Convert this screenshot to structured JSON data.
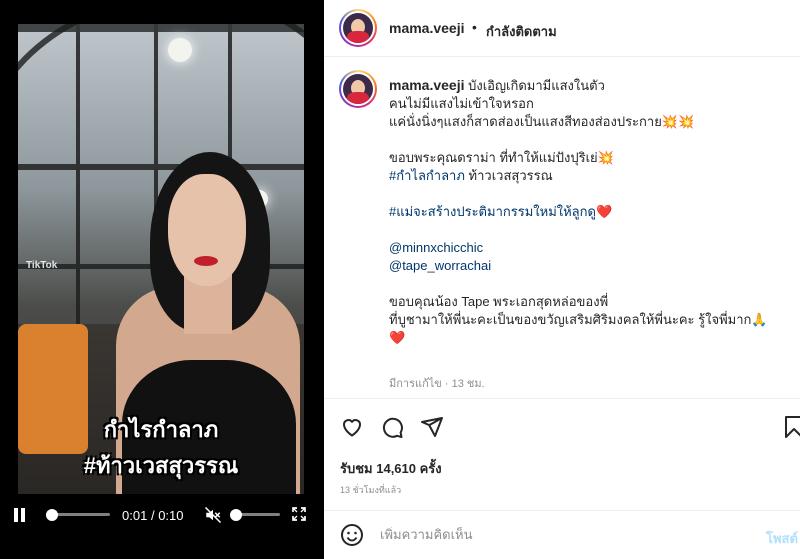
{
  "video": {
    "overlay_line1": "กำไรกำลาภ",
    "overlay_line2": "#ท้าวเวสสุวรรณ",
    "watermark": "TikTok",
    "time_current": "0:01",
    "time_separator": "/",
    "time_total": "0:10",
    "progress_fraction": 0.1,
    "volume_fraction": 0.0
  },
  "header": {
    "username": "mama.veeji",
    "separator": "•",
    "follow_status": "กำลังติดตาม"
  },
  "caption": {
    "username": "mama.veeji",
    "lines": [
      "บังเอิญเกิดมามีแสงในตัว",
      "คนไม่มีแสงไม่เข้าใจหรอก",
      "แค่นั่งนิ่งๆแสงก็สาดส่องเป็นแสงสีทองส่องประกาย💥💥",
      "",
      "ขอบพระคุณดราม่า ที่ทำให้แม่ปังปุริเย่💥",
      "ท้าวเวสสุวรรณ",
      "",
      "❤️",
      "",
      "",
      "",
      "ขอบคุณน้อง Tape พระเอกสุดหล่อของพี่",
      "ที่บูชามาให้พี่นะคะเป็นของขวัญเสริมศิริมงคลให้พี่นะคะ รู้ใจพี่มาก🙏",
      "❤️"
    ],
    "hashtag1": "#กำไลกำลาภ",
    "hashtag2": "#แม่จะสร้างประติมากรรมใหม่ให้ลูกดู",
    "mention1": "@minnxchicchic",
    "mention2": "@tape_worrachai",
    "edited_meta": "มีการแก้ไข · 13 ชม."
  },
  "actions": {
    "like_icon": "heart-icon",
    "comment_icon": "comment-icon",
    "share_icon": "share-icon",
    "save_icon": "bookmark-icon"
  },
  "stats": {
    "views": "รับชม 14,610 ครั้ง",
    "posted_ago": "13 ชั่วโมงที่แล้ว"
  },
  "comment_box": {
    "placeholder": "เพิ่มความคิดเห็น",
    "post_label": "โพสต์"
  },
  "colors": {
    "link": "#00376b",
    "muted": "#8e8e8e",
    "post_button": "#b2dffc",
    "heart": "#ed1c24"
  }
}
